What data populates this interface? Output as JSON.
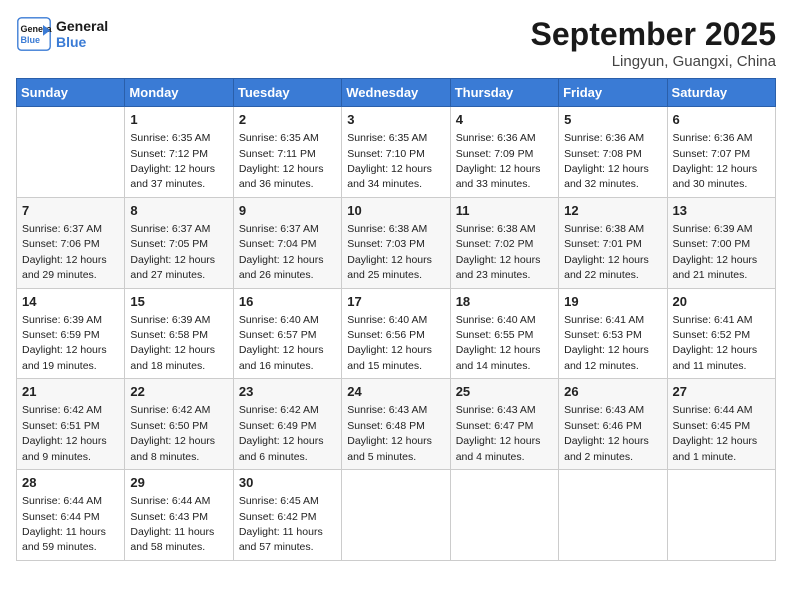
{
  "header": {
    "logo_line1": "General",
    "logo_line2": "Blue",
    "month": "September 2025",
    "location": "Lingyun, Guangxi, China"
  },
  "days": [
    "Sunday",
    "Monday",
    "Tuesday",
    "Wednesday",
    "Thursday",
    "Friday",
    "Saturday"
  ],
  "weeks": [
    [
      {
        "date": "",
        "info": ""
      },
      {
        "date": "1",
        "info": "Sunrise: 6:35 AM\nSunset: 7:12 PM\nDaylight: 12 hours\nand 37 minutes."
      },
      {
        "date": "2",
        "info": "Sunrise: 6:35 AM\nSunset: 7:11 PM\nDaylight: 12 hours\nand 36 minutes."
      },
      {
        "date": "3",
        "info": "Sunrise: 6:35 AM\nSunset: 7:10 PM\nDaylight: 12 hours\nand 34 minutes."
      },
      {
        "date": "4",
        "info": "Sunrise: 6:36 AM\nSunset: 7:09 PM\nDaylight: 12 hours\nand 33 minutes."
      },
      {
        "date": "5",
        "info": "Sunrise: 6:36 AM\nSunset: 7:08 PM\nDaylight: 12 hours\nand 32 minutes."
      },
      {
        "date": "6",
        "info": "Sunrise: 6:36 AM\nSunset: 7:07 PM\nDaylight: 12 hours\nand 30 minutes."
      }
    ],
    [
      {
        "date": "7",
        "info": "Sunrise: 6:37 AM\nSunset: 7:06 PM\nDaylight: 12 hours\nand 29 minutes."
      },
      {
        "date": "8",
        "info": "Sunrise: 6:37 AM\nSunset: 7:05 PM\nDaylight: 12 hours\nand 27 minutes."
      },
      {
        "date": "9",
        "info": "Sunrise: 6:37 AM\nSunset: 7:04 PM\nDaylight: 12 hours\nand 26 minutes."
      },
      {
        "date": "10",
        "info": "Sunrise: 6:38 AM\nSunset: 7:03 PM\nDaylight: 12 hours\nand 25 minutes."
      },
      {
        "date": "11",
        "info": "Sunrise: 6:38 AM\nSunset: 7:02 PM\nDaylight: 12 hours\nand 23 minutes."
      },
      {
        "date": "12",
        "info": "Sunrise: 6:38 AM\nSunset: 7:01 PM\nDaylight: 12 hours\nand 22 minutes."
      },
      {
        "date": "13",
        "info": "Sunrise: 6:39 AM\nSunset: 7:00 PM\nDaylight: 12 hours\nand 21 minutes."
      }
    ],
    [
      {
        "date": "14",
        "info": "Sunrise: 6:39 AM\nSunset: 6:59 PM\nDaylight: 12 hours\nand 19 minutes."
      },
      {
        "date": "15",
        "info": "Sunrise: 6:39 AM\nSunset: 6:58 PM\nDaylight: 12 hours\nand 18 minutes."
      },
      {
        "date": "16",
        "info": "Sunrise: 6:40 AM\nSunset: 6:57 PM\nDaylight: 12 hours\nand 16 minutes."
      },
      {
        "date": "17",
        "info": "Sunrise: 6:40 AM\nSunset: 6:56 PM\nDaylight: 12 hours\nand 15 minutes."
      },
      {
        "date": "18",
        "info": "Sunrise: 6:40 AM\nSunset: 6:55 PM\nDaylight: 12 hours\nand 14 minutes."
      },
      {
        "date": "19",
        "info": "Sunrise: 6:41 AM\nSunset: 6:53 PM\nDaylight: 12 hours\nand 12 minutes."
      },
      {
        "date": "20",
        "info": "Sunrise: 6:41 AM\nSunset: 6:52 PM\nDaylight: 12 hours\nand 11 minutes."
      }
    ],
    [
      {
        "date": "21",
        "info": "Sunrise: 6:42 AM\nSunset: 6:51 PM\nDaylight: 12 hours\nand 9 minutes."
      },
      {
        "date": "22",
        "info": "Sunrise: 6:42 AM\nSunset: 6:50 PM\nDaylight: 12 hours\nand 8 minutes."
      },
      {
        "date": "23",
        "info": "Sunrise: 6:42 AM\nSunset: 6:49 PM\nDaylight: 12 hours\nand 6 minutes."
      },
      {
        "date": "24",
        "info": "Sunrise: 6:43 AM\nSunset: 6:48 PM\nDaylight: 12 hours\nand 5 minutes."
      },
      {
        "date": "25",
        "info": "Sunrise: 6:43 AM\nSunset: 6:47 PM\nDaylight: 12 hours\nand 4 minutes."
      },
      {
        "date": "26",
        "info": "Sunrise: 6:43 AM\nSunset: 6:46 PM\nDaylight: 12 hours\nand 2 minutes."
      },
      {
        "date": "27",
        "info": "Sunrise: 6:44 AM\nSunset: 6:45 PM\nDaylight: 12 hours\nand 1 minute."
      }
    ],
    [
      {
        "date": "28",
        "info": "Sunrise: 6:44 AM\nSunset: 6:44 PM\nDaylight: 11 hours\nand 59 minutes."
      },
      {
        "date": "29",
        "info": "Sunrise: 6:44 AM\nSunset: 6:43 PM\nDaylight: 11 hours\nand 58 minutes."
      },
      {
        "date": "30",
        "info": "Sunrise: 6:45 AM\nSunset: 6:42 PM\nDaylight: 11 hours\nand 57 minutes."
      },
      {
        "date": "",
        "info": ""
      },
      {
        "date": "",
        "info": ""
      },
      {
        "date": "",
        "info": ""
      },
      {
        "date": "",
        "info": ""
      }
    ]
  ]
}
